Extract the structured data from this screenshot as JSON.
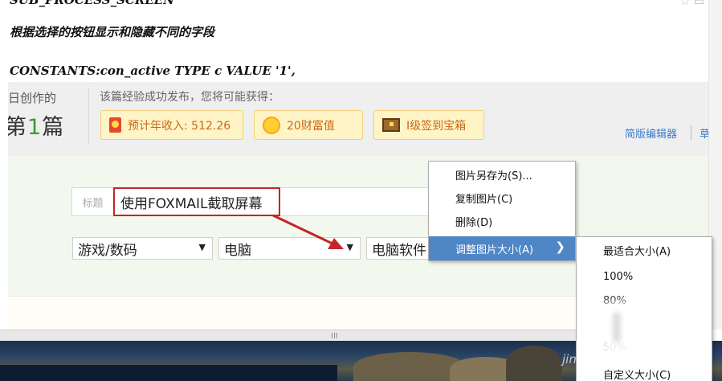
{
  "editor": {
    "code_top": "SUB_PROCESS_SCREEN",
    "comment": "根据选择的按钮显示和隐藏不同的字段",
    "constants": "CONSTANTS:con_active TYPE c VALUE '1',"
  },
  "stats": {
    "day_created": "日创作的",
    "count_prefix": "第",
    "count_number": "1",
    "count_suffix": "篇",
    "gain_hint": "该篇经验成功发布，您将可能获得："
  },
  "rewards": {
    "income": "预计年收入: 512.26",
    "wealth": "20财富值",
    "chest": "I级签到宝箱"
  },
  "links": {
    "simple_editor": "简版编辑器",
    "extra": "草"
  },
  "form": {
    "title_label": "标题",
    "title_value": "使用FOXMAIL截取屏幕",
    "category": "游戏/数码",
    "subcategory": "电脑",
    "third": "电脑软件",
    "arrow_glyph": "▼"
  },
  "context_menu": {
    "save_image_as": "图片另存为(S)...",
    "copy_image": "复制图片(C)",
    "delete": "删除(D)",
    "resize_image": "调整图片大小(A)",
    "submenu_arrow": "❯"
  },
  "submenu": {
    "best_fit": "最适合大小(A)",
    "p100": "100%",
    "p80": "80%",
    "p50": "50%",
    "custom": "自定义大小(C)"
  },
  "scroll": {
    "grip": "III"
  },
  "watermark": "jing"
}
